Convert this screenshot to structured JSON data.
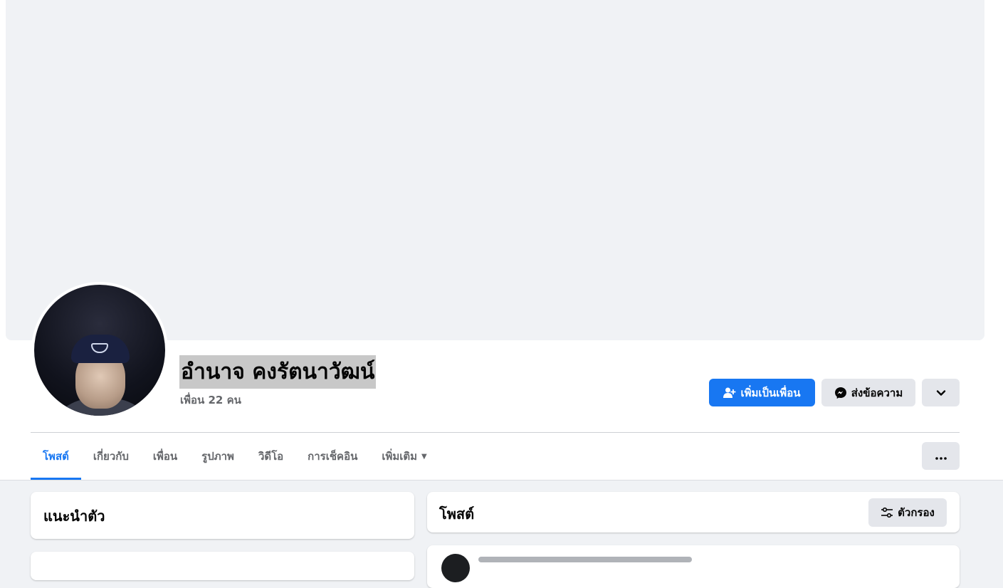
{
  "profile": {
    "name": "อำนาจ คงรัตนาวัฒน์",
    "friends_count": "เพื่อน 22 คน"
  },
  "actions": {
    "add_friend_label": "เพิ่มเป็นเพื่อน",
    "message_label": "ส่งข้อความ"
  },
  "tabs": [
    {
      "label": "โพสต์",
      "active": true
    },
    {
      "label": "เกี่ยวกับ"
    },
    {
      "label": "เพื่อน"
    },
    {
      "label": "รูปภาพ"
    },
    {
      "label": "วิดีโอ"
    },
    {
      "label": "การเช็คอิน"
    },
    {
      "label": "เพิ่มเติม"
    }
  ],
  "intro": {
    "title": "แนะนำตัว"
  },
  "posts": {
    "title": "โพสต์",
    "filter_label": "ตัวกรอง"
  },
  "colors": {
    "accent": "#1877f2",
    "secondary_button": "#e4e6eb",
    "page_background": "#f0f2f5"
  }
}
